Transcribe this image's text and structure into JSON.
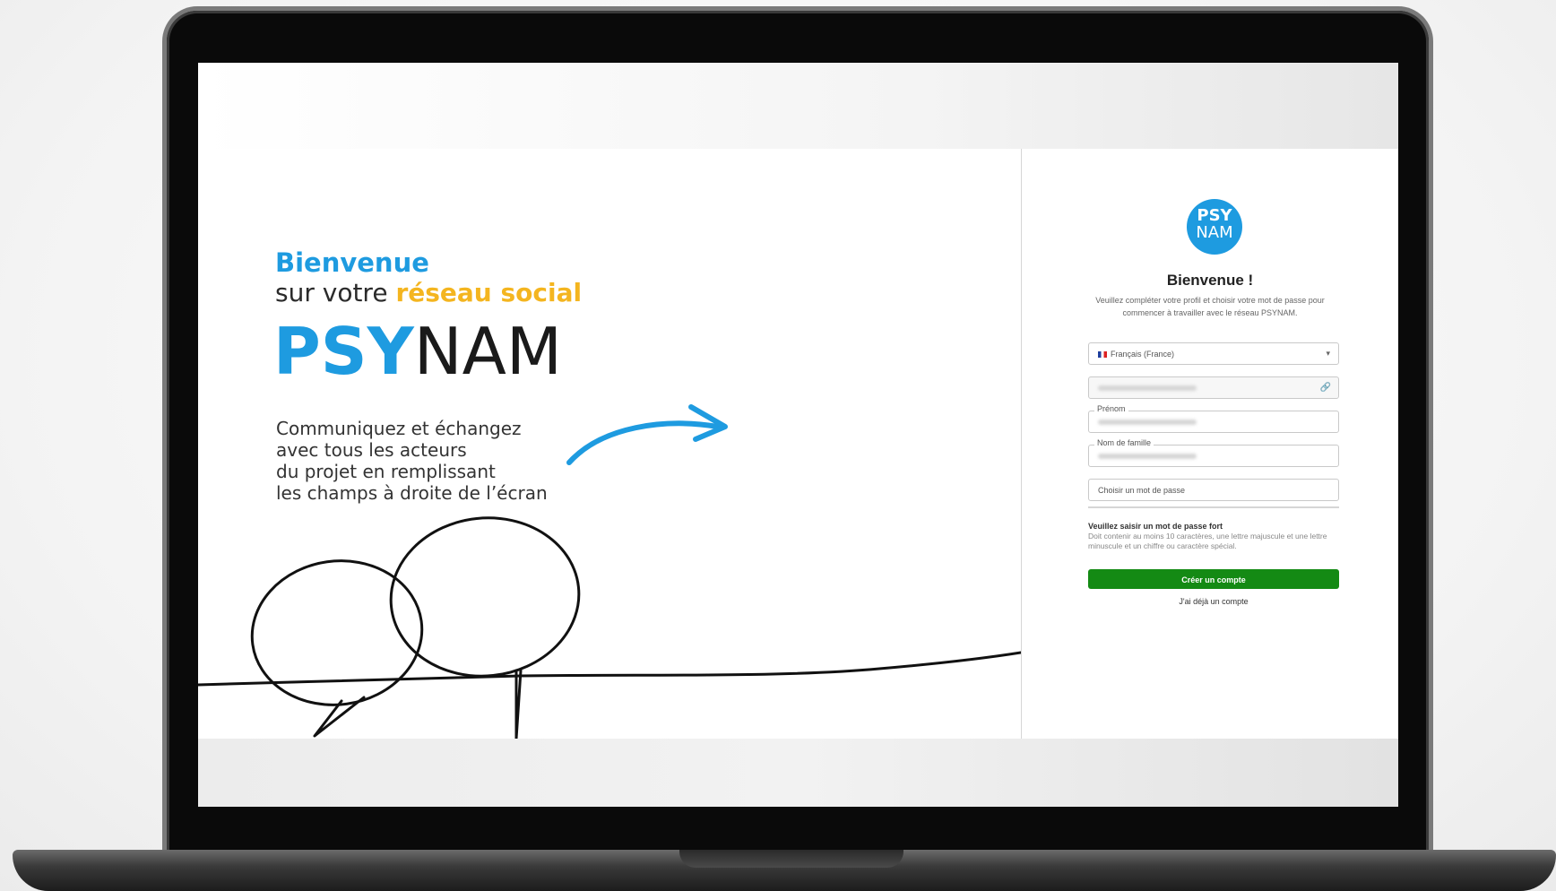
{
  "hero": {
    "title_line1": "Bienvenue",
    "title_line2_prefix": "sur votre ",
    "title_line2_accent": "réseau social",
    "brand_bold": "PSY",
    "brand_light": "NAM",
    "tagline": [
      "Communiquez et échangez",
      "avec tous les acteurs",
      "du projet en remplissant",
      "les champs à droite de l’écran"
    ]
  },
  "form": {
    "logo_line1": "PSY",
    "logo_line2": "NAM",
    "title": "Bienvenue !",
    "subtitle": "Veuillez compléter votre profil et choisir votre mot de passe pour commencer à travailler avec le réseau PSYNAM.",
    "language_value": "Français (France)",
    "firstname_label": "Prénom",
    "lastname_label": "Nom de famille",
    "password_placeholder": "Choisir un mot de passe",
    "password_hint_title": "Veuillez saisir un mot de passe fort",
    "password_hint_text": "Doit contenir au moins 10 caractères, une lettre majuscule et une lettre minuscule et un chiffre ou caractère spécial.",
    "create_button": "Créer un compte",
    "have_account_link": "J'ai déjà un compte"
  },
  "colors": {
    "brand_blue": "#1e9be0",
    "accent_yellow": "#f4b51f",
    "button_green": "#148a14"
  },
  "icons": {
    "language_select": "chevron-down-icon",
    "email_field": "link-icon",
    "language_flag": "france-flag-icon"
  }
}
